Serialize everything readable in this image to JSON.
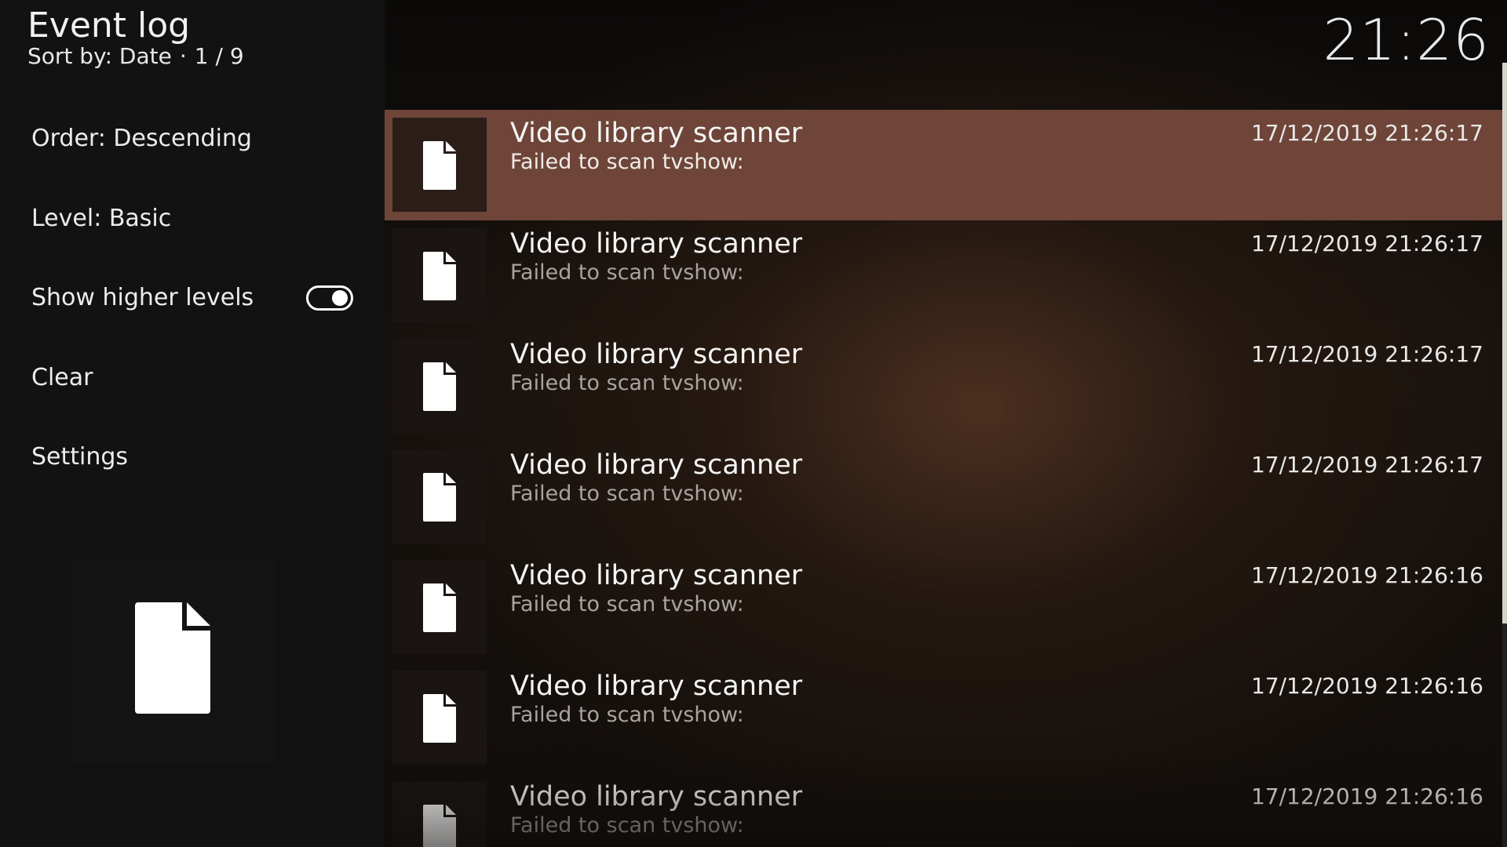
{
  "header": {
    "title": "Event log",
    "sort_label": "Sort by: Date",
    "separator": "·",
    "page": "1 / 9"
  },
  "clock": "21:26",
  "sidebar": {
    "items": [
      {
        "label": "Order: Descending"
      },
      {
        "label": "Level: Basic"
      },
      {
        "label": "Show higher levels",
        "toggle_on": true
      },
      {
        "label": "Clear"
      },
      {
        "label": "Settings"
      }
    ],
    "preview_icon": "file-icon"
  },
  "events": [
    {
      "title": "Video library scanner",
      "message": "Failed to scan tvshow:",
      "timestamp": "17/12/2019 21:26:17",
      "icon": "file-icon",
      "selected": true
    },
    {
      "title": "Video library scanner",
      "message": "Failed to scan tvshow:",
      "timestamp": "17/12/2019 21:26:17",
      "icon": "file-icon"
    },
    {
      "title": "Video library scanner",
      "message": "Failed to scan tvshow:",
      "timestamp": "17/12/2019 21:26:17",
      "icon": "file-icon"
    },
    {
      "title": "Video library scanner",
      "message": "Failed to scan tvshow:",
      "timestamp": "17/12/2019 21:26:17",
      "icon": "file-icon"
    },
    {
      "title": "Video library scanner",
      "message": "Failed to scan tvshow:",
      "timestamp": "17/12/2019 21:26:16",
      "icon": "file-icon"
    },
    {
      "title": "Video library scanner",
      "message": "Failed to scan tvshow:",
      "timestamp": "17/12/2019 21:26:16",
      "icon": "file-icon"
    },
    {
      "title": "Video library scanner",
      "message": "Failed to scan tvshow:",
      "timestamp": "17/12/2019 21:26:16",
      "icon": "file-icon"
    }
  ],
  "scroll_position": 0.0,
  "colors": {
    "selected_row": "#6e4538",
    "sidebar_bg": "#121212",
    "text_primary": "#f4f4f4",
    "text_secondary": "#a9a39f"
  }
}
